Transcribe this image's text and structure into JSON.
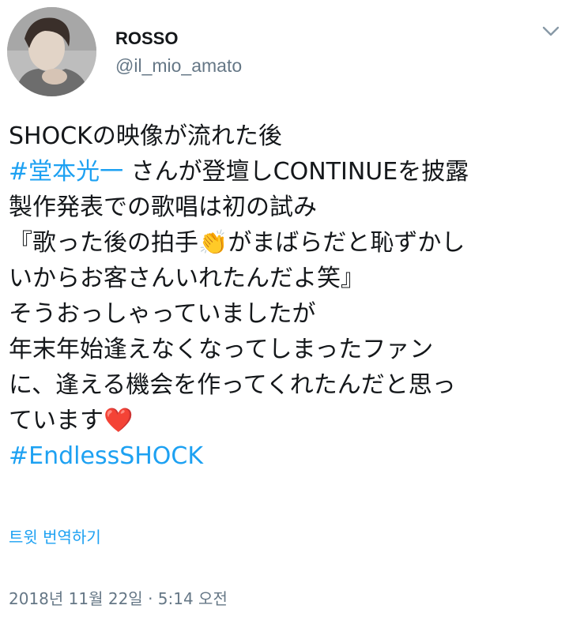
{
  "author": {
    "name": "ROSSO",
    "handle": "@il_mio_amato",
    "avatar_icon": "profile-photo"
  },
  "menu_icon": "chevron-down-icon",
  "tweet": {
    "line1": "SHOCKの映像が流れた後",
    "line2_hashtag": "#堂本光一",
    "line2_rest": " さんが登壇しCONTINUEを披露",
    "line3": "製作発表での歌唱は初の試み",
    "line4_pre": "『歌った後の拍手",
    "line4_emoji": "👏",
    "line4_post": "がまばらだと恥ずかし",
    "line5": "いからお客さんいれたんだよ笑』",
    "line6": "そうおっしゃっていましたが",
    "line7": "年末年始逢えなくなってしまったファン",
    "line8": "に、逢える機会を作ってくれたんだと思っ",
    "line9_text": "ています",
    "line9_emoji": "❤️",
    "line10_hashtag": "#EndlessSHOCK"
  },
  "translate_label": "트윗 번역하기",
  "timestamp": "2018년 11월 22일 · 5:14 오전",
  "colors": {
    "link": "#1da1f2",
    "secondary": "#657786",
    "text": "#14171a",
    "heart": "#dd2e44"
  }
}
